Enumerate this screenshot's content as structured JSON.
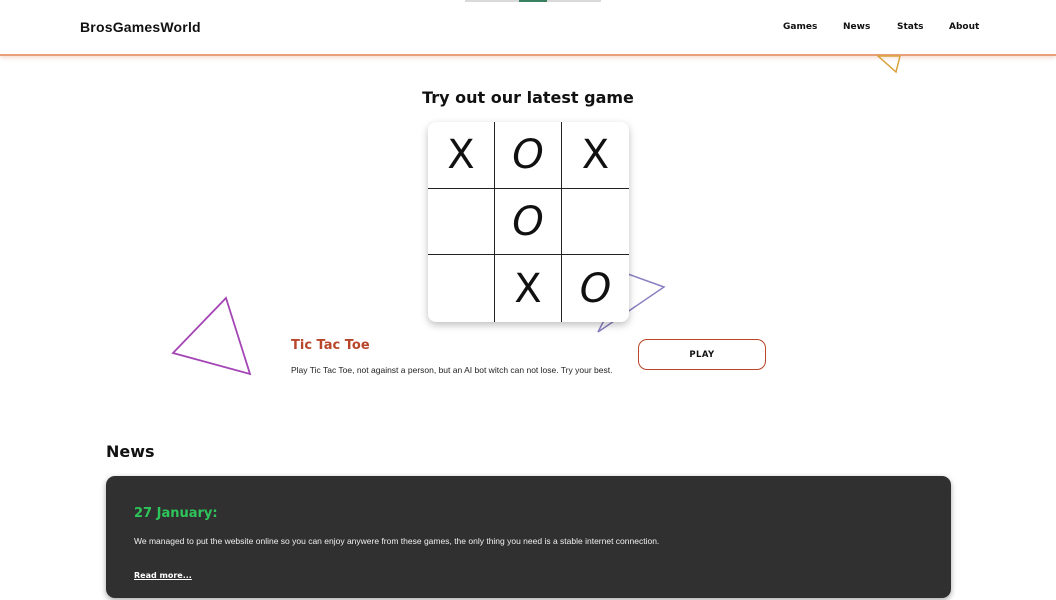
{
  "header": {
    "logo": "BrosGamesWorld",
    "nav": [
      "Games",
      "News",
      "Stats",
      "About"
    ]
  },
  "hero": {
    "title": "Try out our latest game",
    "board": [
      "X",
      "O",
      "X",
      "",
      "O",
      "",
      "",
      "X",
      "O"
    ],
    "game_title": "Tic Tac Toe",
    "game_description": "Play Tic Tac Toe, not against a person, but an AI bot witch can not lose. Try your best.",
    "play_label": "PLAY"
  },
  "news": {
    "heading": "News",
    "items": [
      {
        "date": "27 January:",
        "text": "We managed to put the website online so you can enjoy anywere from these games, the only thing you need is a stable internet connection.",
        "link": "Read more..."
      }
    ]
  },
  "colors": {
    "accent": "#b8462a",
    "news_date": "#2ec55a",
    "news_bg": "#313031"
  }
}
